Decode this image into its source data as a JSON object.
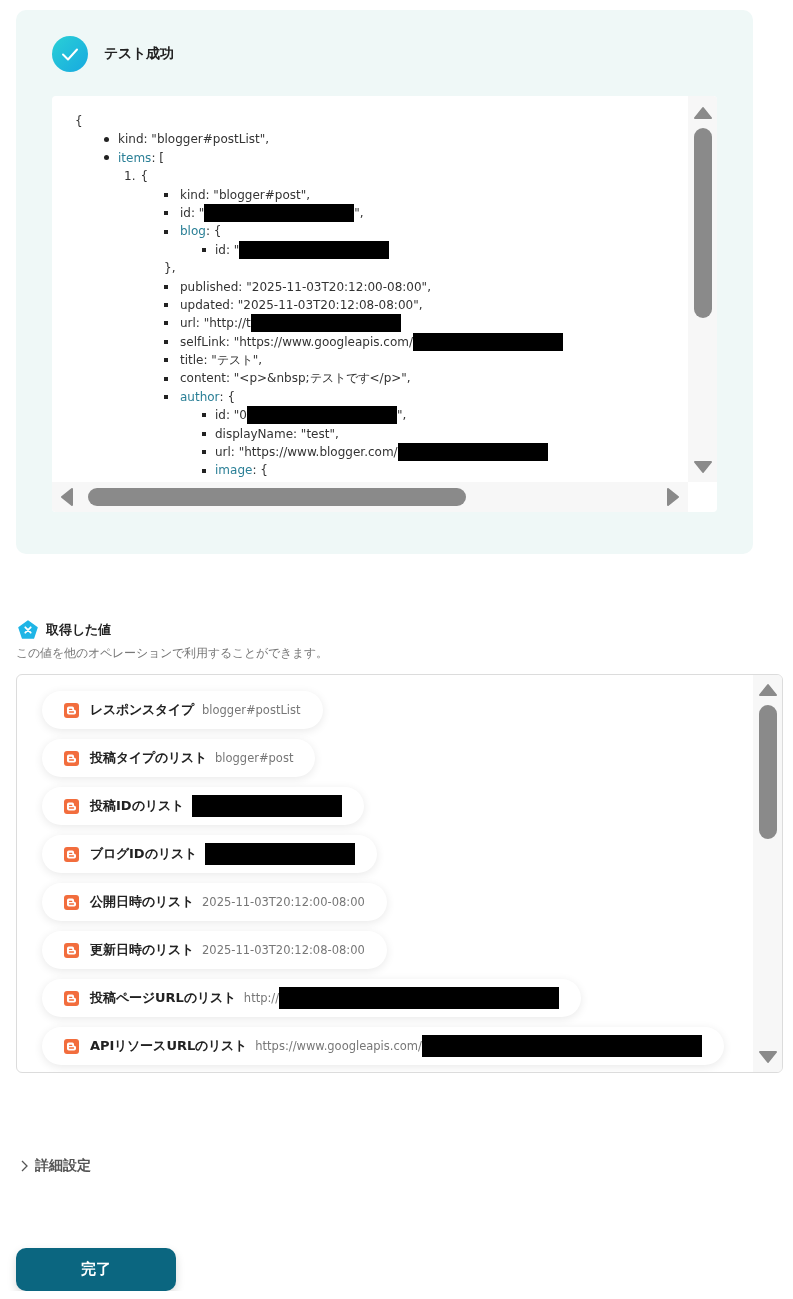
{
  "test_result": {
    "title": "テスト成功",
    "tree": {
      "text": "{",
      "children": [
        {
          "text": "kind: \"blogger#postList\","
        },
        {
          "key": "items",
          "text": ": [",
          "children": [
            {
              "marker": "1.",
              "text": "{",
              "children": [
                {
                  "text": "kind: \"blogger#post\","
                },
                {
                  "text": "id: \"",
                  "redacted": true,
                  "after": "\","
                },
                {
                  "key": "blog",
                  "text": ": {",
                  "children": [
                    {
                      "text": "id: \"",
                      "redacted": true
                    }
                  ],
                  "close": "},"
                },
                {
                  "text": "published: \"2025-11-03T20:12:00-08:00\","
                },
                {
                  "text": "updated: \"2025-11-03T20:12:08-08:00\","
                },
                {
                  "text": "url: \"http://t",
                  "redacted": true
                },
                {
                  "text": "selfLink: \"https://www.googleapis.com/",
                  "redacted": true
                },
                {
                  "text": "title: \"テスト\","
                },
                {
                  "text": "content: \"<p>&nbsp;テストです</p>\","
                },
                {
                  "key": "author",
                  "text": ": {",
                  "children": [
                    {
                      "text": "id: \"0",
                      "redacted": true,
                      "after": "\","
                    },
                    {
                      "text": "displayName: \"test\","
                    },
                    {
                      "text": "url: \"https://www.blogger.com/",
                      "redacted": true
                    },
                    {
                      "key": "image",
                      "text": ": {"
                    }
                  ]
                }
              ]
            }
          ]
        }
      ]
    }
  },
  "outputs": {
    "title": "取得した値",
    "description": "この値を他のオペレーションで利用することができます。",
    "items": [
      {
        "label": "レスポンスタイプ",
        "value": "blogger#postList"
      },
      {
        "label": "投稿タイプのリスト",
        "value": "blogger#post"
      },
      {
        "label": "投稿IDのリスト",
        "redacted": true
      },
      {
        "label": "ブログIDのリスト",
        "redacted": true
      },
      {
        "label": "公開日時のリスト",
        "value": "2025-11-03T20:12:00-08:00"
      },
      {
        "label": "更新日時のリスト",
        "value": "2025-11-03T20:12:08-08:00"
      },
      {
        "label": "投稿ページURLのリスト",
        "value": "http://",
        "redacted": true
      },
      {
        "label": "APIリソースURLのリスト",
        "value": "https://www.googleapis.com/",
        "redacted": true
      }
    ]
  },
  "details": {
    "label": "詳細設定",
    "expanded": false
  },
  "buttons": [
    {
      "label": "完了"
    }
  ]
}
